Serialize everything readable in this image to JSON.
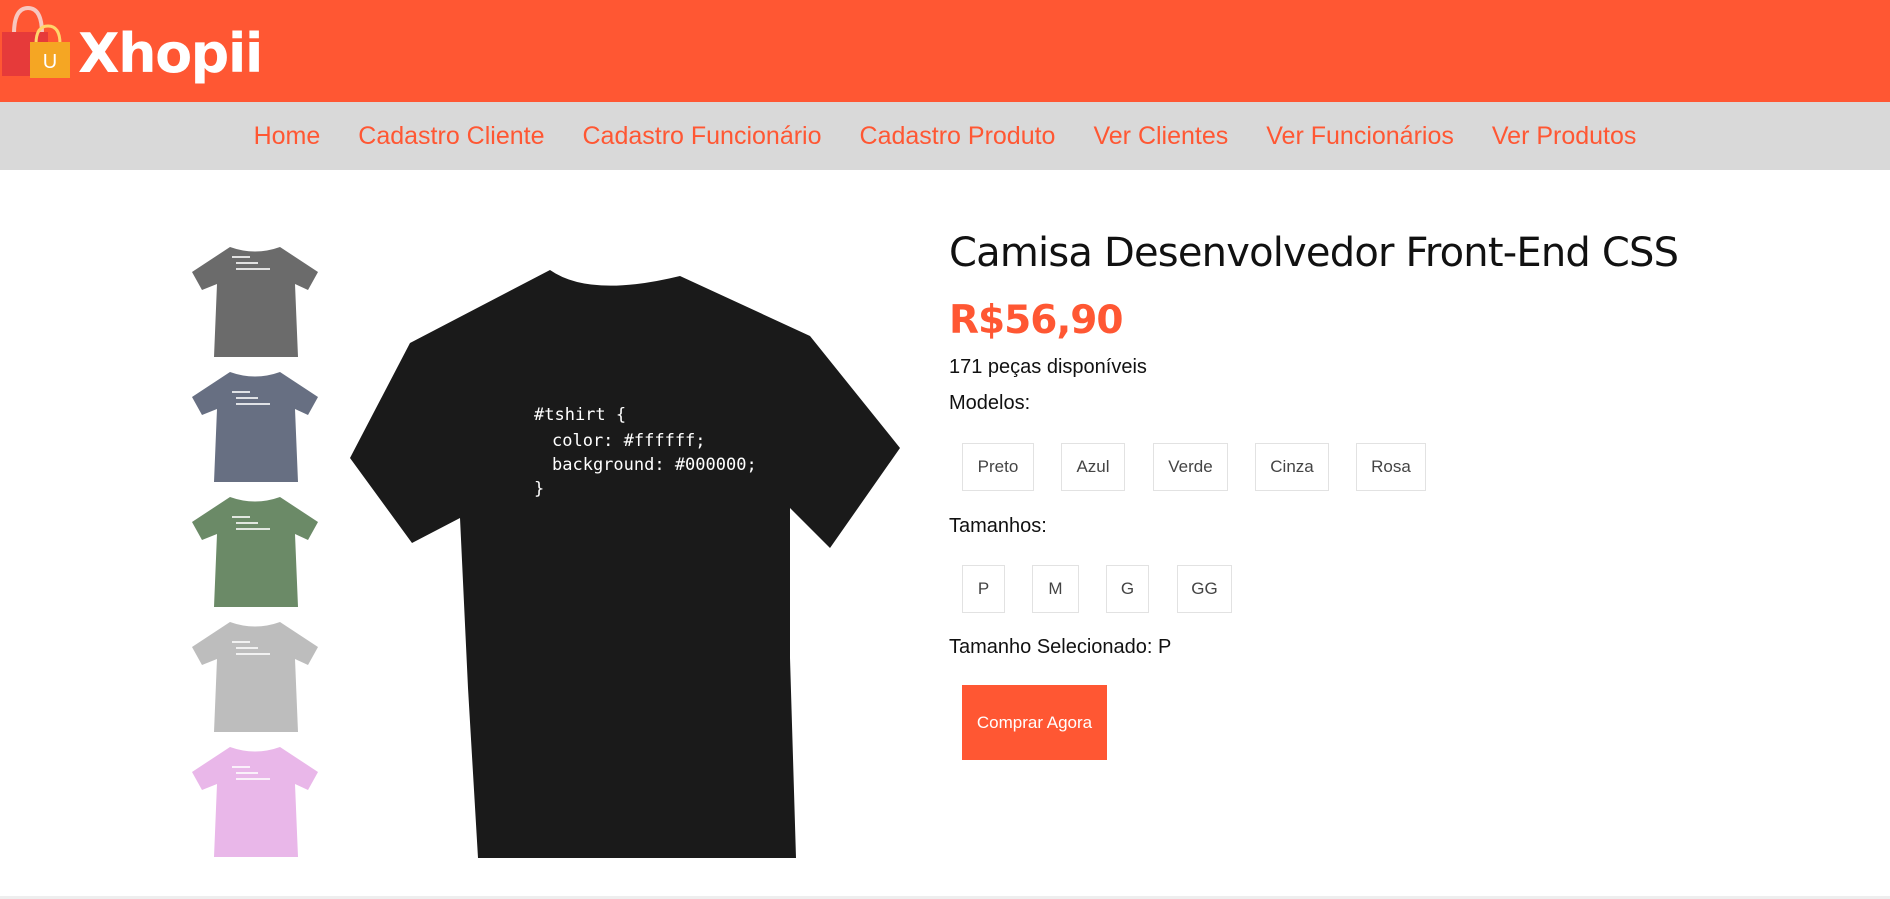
{
  "header": {
    "brand": "Xhopii",
    "logo_letter": "U",
    "colors": {
      "accent": "#ff5733",
      "nav_bg": "#d9d9d9"
    }
  },
  "nav": {
    "items": [
      {
        "label": "Home"
      },
      {
        "label": "Cadastro Cliente"
      },
      {
        "label": "Cadastro Funcionário"
      },
      {
        "label": "Cadastro Produto"
      },
      {
        "label": "Ver Clientes"
      },
      {
        "label": "Ver Funcionários"
      },
      {
        "label": "Ver Produtos"
      }
    ]
  },
  "gallery": {
    "thumbnails": [
      {
        "color": "#6b6b6b"
      },
      {
        "color": "#676f82"
      },
      {
        "color": "#6b8a67"
      },
      {
        "color": "#bdbdbd"
      },
      {
        "color": "#e9b7e9"
      }
    ],
    "main_color": "#1a1a1a",
    "shirt_code": [
      "#tshirt {",
      "  color: #ffffff;",
      "  background: #000000;",
      "}"
    ]
  },
  "product": {
    "title": "Camisa Desenvolvedor Front-End CSS",
    "price": "R$56,90",
    "stock": "171 peças disponíveis",
    "models_label": "Modelos:",
    "models": [
      "Preto",
      "Azul",
      "Verde",
      "Cinza",
      "Rosa"
    ],
    "sizes_label": "Tamanhos:",
    "sizes": [
      "P",
      "M",
      "G",
      "GG"
    ],
    "selected_size": "Tamanho Selecionado: P",
    "buy_label": "Comprar Agora"
  }
}
